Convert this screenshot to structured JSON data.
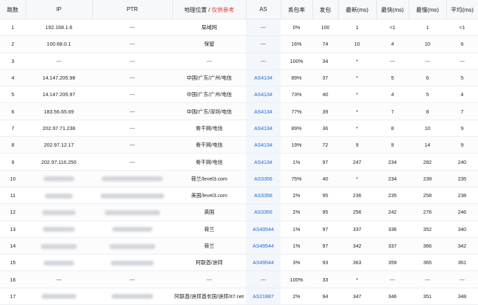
{
  "header": {
    "hop": "跳数",
    "ip": "IP",
    "ptr": "PTR",
    "geo": "地理位置 / ",
    "geo_note": "仅供参考",
    "as": "AS",
    "loss": "丢包率",
    "sent": "发包",
    "latest": "最新(ms)",
    "best": "最快(ms)",
    "worst": "最慢(ms)",
    "avg": "平均(ms)"
  },
  "rows": [
    {
      "hop": "1",
      "ip": "192.168.1.6",
      "ptr": "---",
      "geo": "局域网",
      "as": "---",
      "loss": "0%",
      "sent": "100",
      "latest": "1",
      "best": "<1",
      "worst": "1",
      "avg": "<1"
    },
    {
      "hop": "2",
      "ip": "100.68.0.1",
      "ptr": "---",
      "geo": "保留",
      "as": "---",
      "loss": "16%",
      "sent": "74",
      "latest": "10",
      "best": "4",
      "worst": "10",
      "avg": "6"
    },
    {
      "hop": "3",
      "ip": "---",
      "ptr": "---",
      "geo": "---",
      "as": "---",
      "loss": "100%",
      "sent": "34",
      "latest": "*",
      "best": "---",
      "worst": "---",
      "avg": "---"
    },
    {
      "hop": "4",
      "ip": "14.147.205.98",
      "ptr": "---",
      "geo": "中国/广东/广州/电信",
      "as": "AS4134",
      "loss": "89%",
      "sent": "37",
      "latest": "*",
      "best": "5",
      "worst": "6",
      "avg": "5"
    },
    {
      "hop": "5",
      "ip": "14.147.205.97",
      "ptr": "---",
      "geo": "中国/广东/广州/电信",
      "as": "AS4134",
      "loss": "73%",
      "sent": "40",
      "latest": "*",
      "best": "4",
      "worst": "5",
      "avg": "4"
    },
    {
      "hop": "6",
      "ip": "183.56.65.69",
      "ptr": "---",
      "geo": "中国/广东/深圳/电信",
      "as": "AS4134",
      "loss": "77%",
      "sent": "39",
      "latest": "*",
      "best": "7",
      "worst": "8",
      "avg": "7"
    },
    {
      "hop": "7",
      "ip": "202.97.71.238",
      "ptr": "---",
      "geo": "骨干网/电信",
      "as": "AS4134",
      "loss": "89%",
      "sent": "36",
      "latest": "*",
      "best": "8",
      "worst": "10",
      "avg": "9"
    },
    {
      "hop": "8",
      "ip": "202.97.12.17",
      "ptr": "---",
      "geo": "骨干网/电信",
      "as": "AS4134",
      "loss": "19%",
      "sent": "72",
      "latest": "9",
      "best": "9",
      "worst": "14",
      "avg": "9"
    },
    {
      "hop": "9",
      "ip": "202.97.116.250",
      "ptr": "---",
      "geo": "骨干网/电信",
      "as": "AS4134",
      "loss": "1%",
      "sent": "97",
      "latest": "247",
      "best": "234",
      "worst": "282",
      "avg": "240"
    },
    {
      "hop": "10",
      "ip": "",
      "ptr": "",
      "geo": "荷兰/level3.com",
      "as": "AS3356",
      "loss": "75%",
      "sent": "40",
      "latest": "*",
      "best": "234",
      "worst": "239",
      "avg": "235"
    },
    {
      "hop": "11",
      "ip": "",
      "ptr": "",
      "geo": "美国/level3.com",
      "as": "AS3356",
      "loss": "2%",
      "sent": "95",
      "latest": "236",
      "best": "235",
      "worst": "258",
      "avg": "238"
    },
    {
      "hop": "12",
      "ip": "",
      "ptr": "",
      "geo": "英国",
      "as": "AS3356",
      "loss": "2%",
      "sent": "95",
      "latest": "256",
      "best": "242",
      "worst": "276",
      "avg": "246"
    },
    {
      "hop": "13",
      "ip": "",
      "ptr": "",
      "geo": "荷兰",
      "as": "AS49544",
      "loss": "1%",
      "sent": "97",
      "latest": "337",
      "best": "336",
      "worst": "352",
      "avg": "340"
    },
    {
      "hop": "14",
      "ip": "",
      "ptr": "",
      "geo": "荷兰",
      "as": "AS49544",
      "loss": "1%",
      "sent": "97",
      "latest": "342",
      "best": "337",
      "worst": "366",
      "avg": "342"
    },
    {
      "hop": "15",
      "ip": "",
      "ptr": "",
      "geo": "阿联酋/迪拜",
      "as": "AS49544",
      "loss": "3%",
      "sent": "93",
      "latest": "363",
      "best": "359",
      "worst": "365",
      "avg": "361"
    },
    {
      "hop": "16",
      "ip": "---",
      "ptr": "---",
      "geo": "---",
      "as": "---",
      "loss": "100%",
      "sent": "33",
      "latest": "*",
      "best": "---",
      "worst": "---",
      "avg": "---"
    },
    {
      "hop": "17",
      "ip": "",
      "ptr": "",
      "geo": "阿联酋/迪拜酋长国/迪拜/it7.net",
      "as": "AS21887",
      "loss": "2%",
      "sent": "94",
      "latest": "347",
      "best": "346",
      "worst": "351",
      "avg": "348"
    }
  ],
  "colors": {
    "link": "#1a66d6",
    "danger": "#e0362f",
    "header_bg": "#f7f8fa",
    "as_cell_bg": "#f3f6fa"
  }
}
